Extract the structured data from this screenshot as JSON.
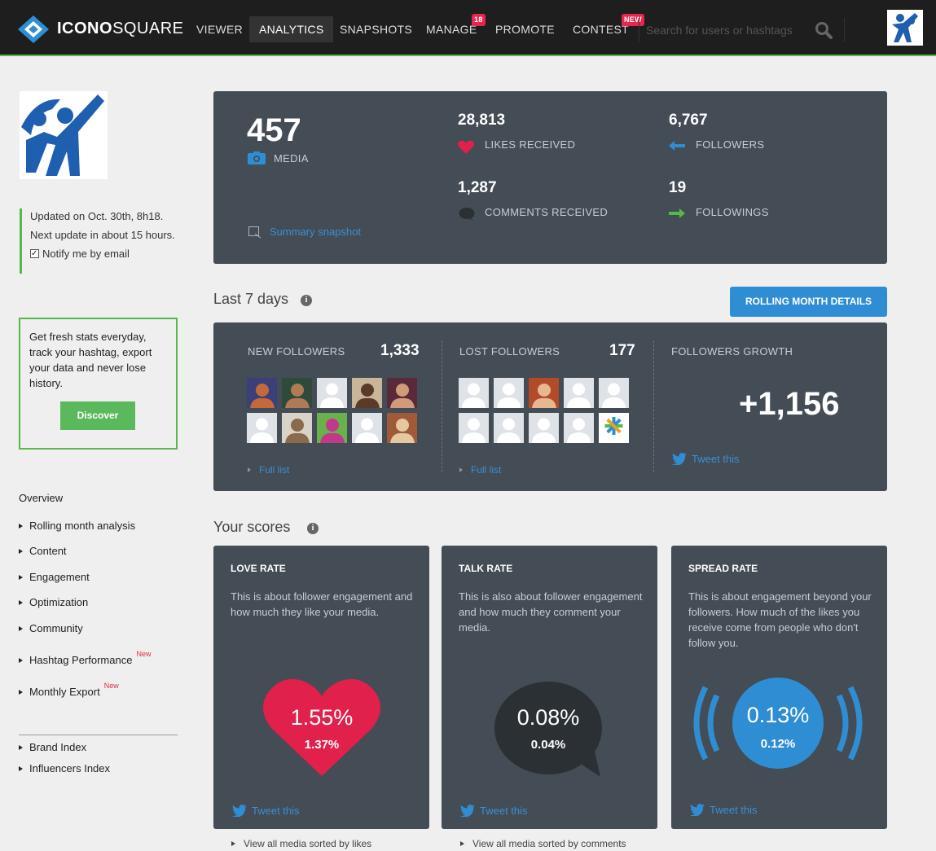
{
  "nav": {
    "logo_bold": "ICONO",
    "logo_light": "SQUARE",
    "items": [
      {
        "label": "VIEWER"
      },
      {
        "label": "ANALYTICS"
      },
      {
        "label": "SNAPSHOTS"
      },
      {
        "label": "MANAGE",
        "badge": "18"
      },
      {
        "label": "PROMOTE"
      },
      {
        "label": "CONTEST",
        "badge": "NEW"
      }
    ],
    "search_placeholder": "Search for users or hashtags"
  },
  "sidebar": {
    "updated": "Updated on Oct. 30th, 8h18.",
    "next_update": "Next update in about 15 hours.",
    "notify": "Notify me by email",
    "promo_text": "Get fresh stats everyday, track your hashtag, export your data and never lose history.",
    "discover": "Discover",
    "menu_head": "Overview",
    "menu": [
      {
        "label": "Rolling month analysis",
        "new": ""
      },
      {
        "label": "Content",
        "new": ""
      },
      {
        "label": "Engagement",
        "new": ""
      },
      {
        "label": "Optimization",
        "new": ""
      },
      {
        "label": "Community",
        "new": ""
      },
      {
        "label": "Hashtag Performance",
        "new": "New"
      },
      {
        "label": "Monthly Export",
        "new": "New"
      }
    ],
    "menu2": [
      {
        "label": "Brand Index"
      },
      {
        "label": "Influencers Index"
      }
    ]
  },
  "summary": {
    "media_count": "457",
    "media_label": "MEDIA",
    "likes": "28,813",
    "likes_label": "LIKES RECEIVED",
    "comments": "1,287",
    "comments_label": "COMMENTS RECEIVED",
    "followers": "6,767",
    "followers_label": "FOLLOWERS",
    "followings": "19",
    "followings_label": "FOLLOWINGS",
    "snapshot_link": "Summary snapshot"
  },
  "last7": {
    "title": "Last 7 days",
    "rolling_button": "ROLLING MONTH DETAILS",
    "new_followers_label": "NEW FOLLOWERS",
    "new_followers": "1,333",
    "lost_followers_label": "LOST FOLLOWERS",
    "lost_followers": "177",
    "growth_label": "FOLLOWERS GROWTH",
    "growth": "+1,156",
    "full_list": "Full list",
    "tweet": "Tweet this"
  },
  "scores": {
    "title": "Your scores",
    "cards": [
      {
        "title": "LOVE RATE",
        "desc": "This is about follower engagement and how much they like your media.",
        "value": "1.55%",
        "sub": "1.37%",
        "tweet": "Tweet this",
        "link": "View all media sorted by likes",
        "color": "#e1204c"
      },
      {
        "title": "TALK RATE",
        "desc": "This is also about follower engagement and how much they comment your media.",
        "value": "0.08%",
        "sub": "0.04%",
        "tweet": "Tweet this",
        "link": "View all media sorted by comments",
        "color": "#2b3035"
      },
      {
        "title": "SPREAD RATE",
        "desc": "This is about engagement beyond your followers. How much of the likes you receive come from people who don't follow you.",
        "value": "0.13%",
        "sub": "0.12%",
        "tweet": "Tweet this",
        "link": "",
        "color": "#2f8ed3"
      }
    ]
  }
}
